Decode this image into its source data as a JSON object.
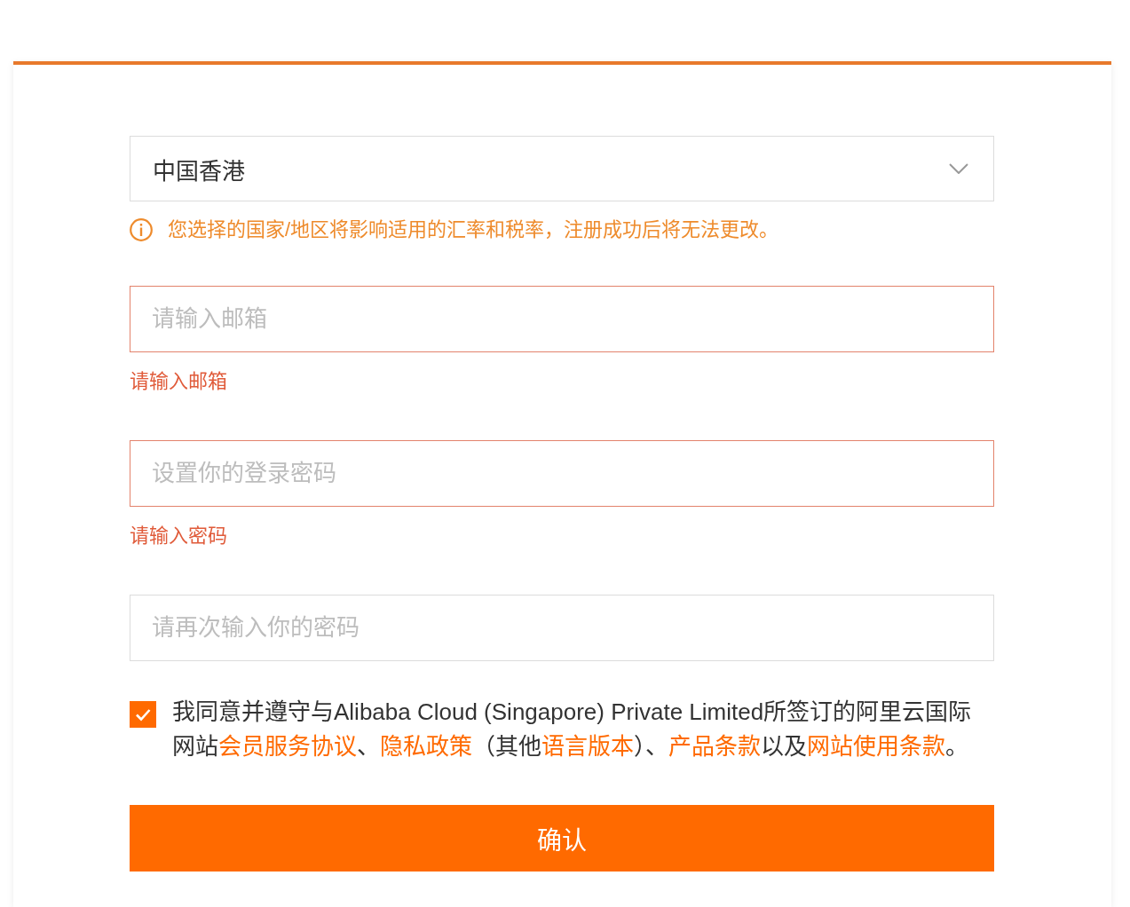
{
  "region_select": {
    "value": "中国香港"
  },
  "region_notice": "您选择的国家/地区将影响适用的汇率和税率，注册成功后将无法更改。",
  "fields": [
    {
      "placeholder": "请输入邮箱",
      "invalid": true,
      "error": "请输入邮箱"
    },
    {
      "placeholder": "设置你的登录密码",
      "invalid": true,
      "error": "请输入密码"
    },
    {
      "placeholder": "请再次输入你的密码",
      "invalid": false
    }
  ],
  "agreement": {
    "checked": true,
    "lines": [
      [
        {
          "kind": "text",
          "text": "我同意并遵守与Alibaba Cloud (Singapore) Private Limited所签订的阿里云国际"
        }
      ],
      [
        {
          "kind": "text",
          "text": "网站"
        },
        {
          "kind": "link",
          "text": "会员服务协议"
        },
        {
          "kind": "text",
          "text": "、"
        },
        {
          "kind": "link",
          "text": "隐私政策"
        },
        {
          "kind": "text",
          "text": "（其他"
        },
        {
          "kind": "link",
          "text": "语言版本"
        },
        {
          "kind": "text",
          "text": "）、"
        },
        {
          "kind": "link",
          "text": "产品条款"
        },
        {
          "kind": "text",
          "text": "以及"
        },
        {
          "kind": "link",
          "text": "网站使用条款"
        },
        {
          "kind": "text",
          "text": "。"
        }
      ]
    ]
  },
  "submit_button": "确认"
}
